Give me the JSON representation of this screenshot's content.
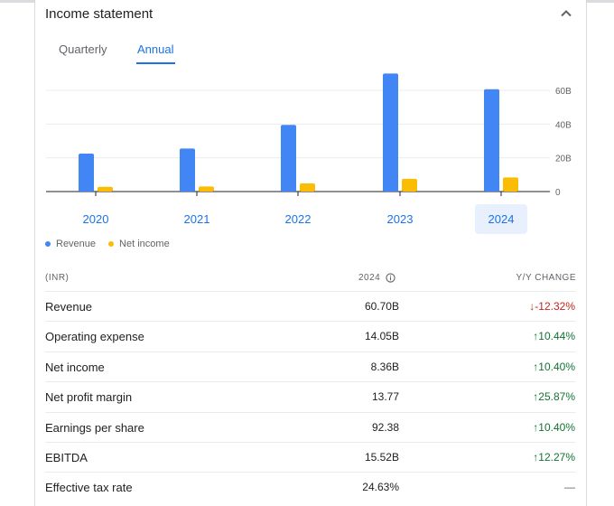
{
  "card": {
    "title": "Income statement"
  },
  "tabs": {
    "quarterly": "Quarterly",
    "annual": "Annual"
  },
  "chart_data": {
    "type": "bar",
    "categories": [
      "2020",
      "2021",
      "2022",
      "2023",
      "2024"
    ],
    "series": [
      {
        "name": "Revenue",
        "values": [
          22.5,
          25.5,
          39.5,
          70.0,
          60.7
        ],
        "color": "#4285f4"
      },
      {
        "name": "Net income",
        "values": [
          2.8,
          3.0,
          4.8,
          7.6,
          8.36
        ],
        "color": "#fbbc04"
      }
    ],
    "ylim": [
      0,
      60
    ],
    "yticks": [
      0,
      20,
      40,
      60
    ],
    "ytick_labels": [
      "0",
      "20B",
      "40B",
      "60B"
    ],
    "selected_category": "2024",
    "legend_position": "bottom-left",
    "grid": true
  },
  "legend": {
    "revenue": "Revenue",
    "net_income": "Net income"
  },
  "table": {
    "header_unit": "(INR)",
    "header_year": "2024",
    "header_change": "Y/Y CHANGE",
    "rows": [
      {
        "label": "Revenue",
        "value": "60.70B",
        "change": "-12.32%",
        "direction": "down"
      },
      {
        "label": "Operating expense",
        "value": "14.05B",
        "change": "10.44%",
        "direction": "up"
      },
      {
        "label": "Net income",
        "value": "8.36B",
        "change": "10.40%",
        "direction": "up"
      },
      {
        "label": "Net profit margin",
        "value": "13.77",
        "change": "25.87%",
        "direction": "up"
      },
      {
        "label": "Earnings per share",
        "value": "92.38",
        "change": "10.40%",
        "direction": "up"
      },
      {
        "label": "EBITDA",
        "value": "15.52B",
        "change": "12.27%",
        "direction": "up"
      },
      {
        "label": "Effective tax rate",
        "value": "24.63%",
        "change": "—",
        "direction": "neutral"
      }
    ]
  }
}
